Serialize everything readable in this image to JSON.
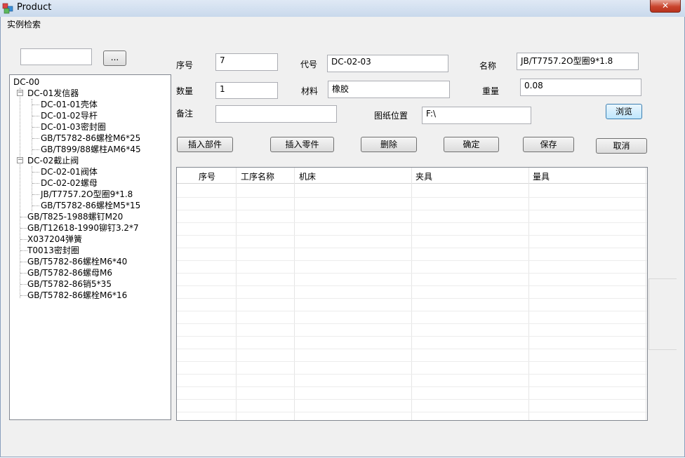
{
  "window": {
    "title": "Product",
    "close_label": "✕"
  },
  "menu": {
    "items": [
      "实例检索"
    ]
  },
  "search": {
    "value": "",
    "browse_button": "..."
  },
  "tree": {
    "root": "DC-00",
    "nodes": [
      {
        "label": "DC-01发信器",
        "level": 1,
        "expanded": true
      },
      {
        "label": "DC-01-01壳体",
        "level": 2
      },
      {
        "label": "DC-01-02导杆",
        "level": 2
      },
      {
        "label": "DC-01-03密封圈",
        "level": 2
      },
      {
        "label": "GB/T5782-86螺栓M6*25",
        "level": 2
      },
      {
        "label": "GB/T899/88螺柱AM6*45",
        "level": 2
      },
      {
        "label": "DC-02截止阀",
        "level": 1,
        "expanded": true
      },
      {
        "label": "DC-02-01阀体",
        "level": 2
      },
      {
        "label": "DC-02-02螺母",
        "level": 2
      },
      {
        "label": "JB/T7757.2O型圈9*1.8",
        "level": 2
      },
      {
        "label": "GB/T5782-86螺栓M5*15",
        "level": 2
      },
      {
        "label": "GB/T825-1988螺钉M20",
        "level": 1
      },
      {
        "label": "GB/T12618-1990铆钉3.2*7",
        "level": 1
      },
      {
        "label": "X037204弹簧",
        "level": 1
      },
      {
        "label": "T0013密封圈",
        "level": 1
      },
      {
        "label": "GB/T5782-86螺栓M6*40",
        "level": 1
      },
      {
        "label": "GB/T5782-86螺母M6",
        "level": 1
      },
      {
        "label": "GB/T5782-86销5*35",
        "level": 1
      },
      {
        "label": "GB/T5782-86螺栓M6*16",
        "level": 1
      }
    ]
  },
  "form": {
    "serial_label": "序号",
    "serial_value": "7",
    "code_label": "代号",
    "code_value": "DC-02-03",
    "name_label": "名称",
    "name_value": "JB/T7757.2O型圈9*1.8",
    "quantity_label": "数量",
    "quantity_value": "1",
    "material_label": "材料",
    "material_value": "橡胶",
    "weight_label": "重量",
    "weight_value": "0.08",
    "remark_label": "备注",
    "remark_value": "",
    "drawing_label": "图纸位置",
    "drawing_value": "F:\\",
    "browse_label": "浏览"
  },
  "actions": {
    "insert_assembly": "插入部件",
    "insert_part": "插入零件",
    "delete": "删除",
    "confirm": "确定",
    "save": "保存",
    "cancel": "取消"
  },
  "grid": {
    "columns": [
      "序号",
      "工序名称",
      "机床",
      "夹具",
      "量具"
    ],
    "rows": []
  },
  "colors": {
    "titlebar": "#c9d9ec",
    "background": "#f0f0f0",
    "close": "#c9452e"
  }
}
